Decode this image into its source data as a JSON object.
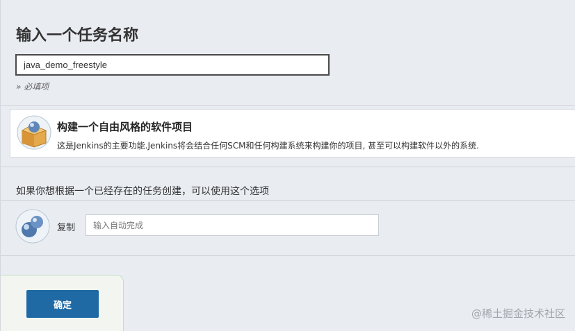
{
  "page": {
    "title": "输入一个任务名称",
    "item_name_value": "java_demo_freestyle",
    "required_note": "» 必填项"
  },
  "job_types": [
    {
      "name": "构建一个自由风格的软件项目",
      "description": "这是Jenkins的主要功能.Jenkins将会结合任何SCM和任何构建系统来构建你的项目, 甚至可以构建软件以外的系统."
    }
  ],
  "copy": {
    "hint": "如果你想根据一个已经存在的任务创建，可以使用这个选项",
    "label": "复制",
    "placeholder": "输入自动完成"
  },
  "footer": {
    "ok_label": "确定"
  },
  "watermark": {
    "text": "@稀土掘金技术社区"
  },
  "icons": {
    "job": "freestyle-project-box-icon",
    "copy": "copy-spheres-icon"
  },
  "colors": {
    "background": "#e9ecf1",
    "primary_button": "#1f6aa5",
    "input_border_focus": "#4a4a4a"
  }
}
